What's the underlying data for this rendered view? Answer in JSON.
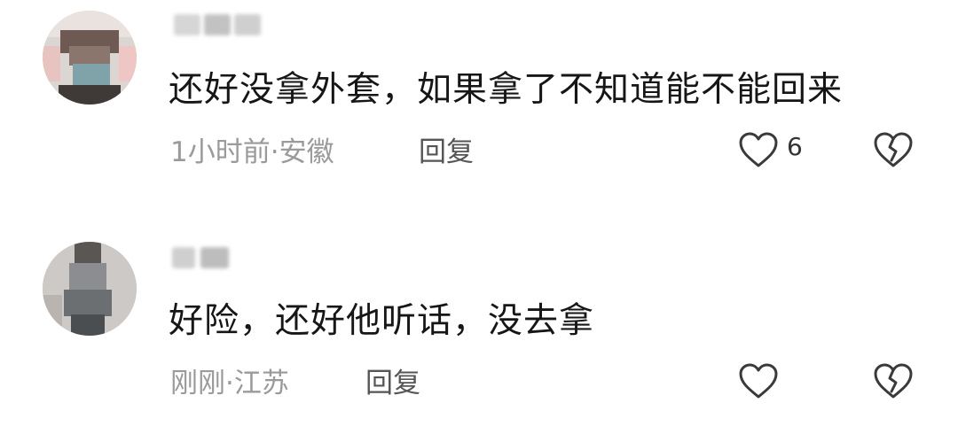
{
  "comments": [
    {
      "username": "",
      "content": "还好没拿外套，如果拿了不知道能不能回来",
      "time": "1小时前",
      "location": "安徽",
      "meta": "1小时前·安徽",
      "reply_label": "回复",
      "like_count": "6"
    },
    {
      "username": "",
      "content": "好险，还好他听话，没去拿",
      "time": "刚刚",
      "location": "江苏",
      "meta": "刚刚·江苏",
      "reply_label": "回复",
      "like_count": ""
    }
  ],
  "icons": {
    "like": "heart-outline-icon",
    "dislike": "broken-heart-outline-icon"
  },
  "colors": {
    "text_primary": "#161616",
    "text_meta": "#9a9a9a",
    "text_reply": "#555555",
    "icon_stroke": "#3a3a3a"
  }
}
